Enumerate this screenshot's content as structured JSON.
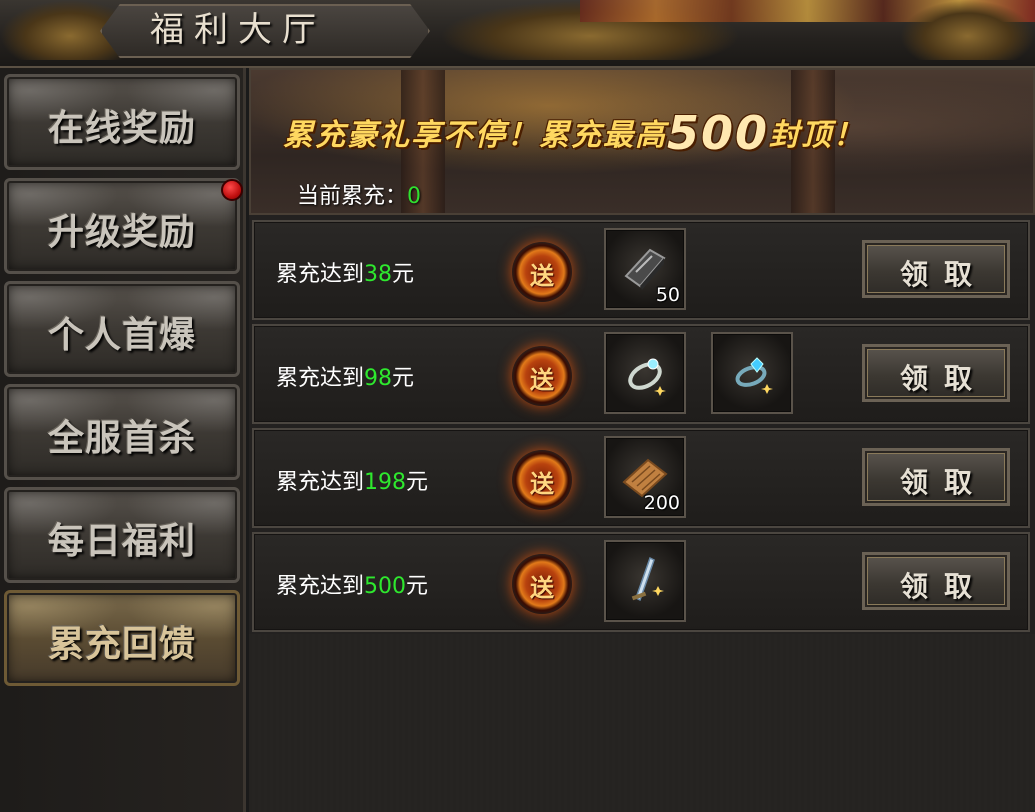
{
  "window": {
    "title": "福利大厅"
  },
  "sidebar": {
    "items": [
      {
        "label": "在线奖励",
        "active": false,
        "badge": false
      },
      {
        "label": "升级奖励",
        "active": false,
        "badge": true
      },
      {
        "label": "个人首爆",
        "active": false,
        "badge": false
      },
      {
        "label": "全服首杀",
        "active": false,
        "badge": false
      },
      {
        "label": "每日福利",
        "active": false,
        "badge": false
      },
      {
        "label": "累充回馈",
        "active": true,
        "badge": false
      }
    ]
  },
  "banner": {
    "headline_pre": "累充豪礼享不停！累充最高",
    "headline_cap": "500",
    "headline_post": "封顶！",
    "current_label": "当前累充：",
    "current_value": "0"
  },
  "rewards": [
    {
      "prefix": "累充达到",
      "amount": "38",
      "suffix": "元",
      "gift_icon": "gift-send-icon",
      "gift_text": "送",
      "items": [
        {
          "icon": "book-icon",
          "qty": "50"
        }
      ],
      "claim_label": "领取"
    },
    {
      "prefix": "累充达到",
      "amount": "98",
      "suffix": "元",
      "gift_icon": "gift-send-icon",
      "gift_text": "送",
      "items": [
        {
          "icon": "ring-icon",
          "qty": ""
        },
        {
          "icon": "gem-ring-icon",
          "qty": ""
        }
      ],
      "claim_label": "领取"
    },
    {
      "prefix": "累充达到",
      "amount": "198",
      "suffix": "元",
      "gift_icon": "gift-send-icon",
      "gift_text": "送",
      "items": [
        {
          "icon": "scroll-icon",
          "qty": "200"
        }
      ],
      "claim_label": "领取"
    },
    {
      "prefix": "累充达到",
      "amount": "500",
      "suffix": "元",
      "gift_icon": "gift-send-icon",
      "gift_text": "送",
      "items": [
        {
          "icon": "sword-icon",
          "qty": ""
        }
      ],
      "claim_label": "领取"
    }
  ],
  "colors": {
    "amount_green": "#2ee82e",
    "banner_gold": "#ffd860",
    "badge_red": "#e01818"
  }
}
